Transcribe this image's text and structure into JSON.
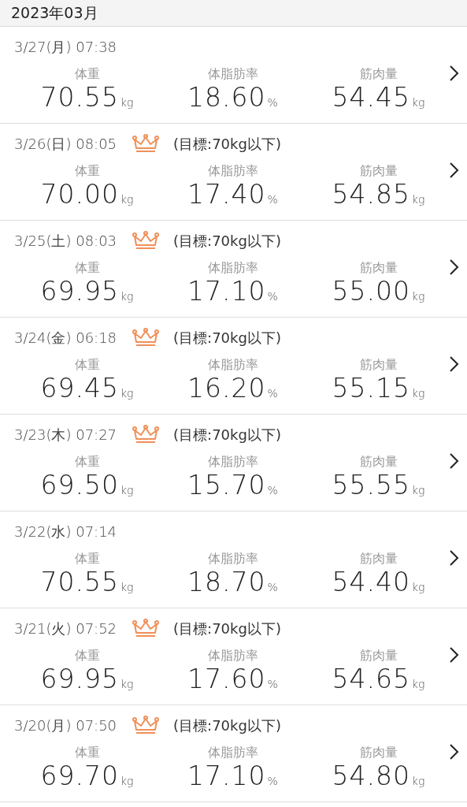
{
  "header": {
    "title": "2023年03月"
  },
  "entries": [
    {
      "date": "3/27(月)",
      "time": "07:38",
      "achieved": false,
      "metrics": [
        {
          "label": "体重",
          "value": "70.55",
          "unit": "kg"
        },
        {
          "label": "体脂肪率",
          "value": "18.60",
          "unit": "%"
        },
        {
          "label": "筋肉量",
          "value": "54.45",
          "unit": "kg"
        }
      ]
    },
    {
      "date": "3/26(日)",
      "time": "08:05",
      "achieved": true,
      "goal": "(目標:70kg以下)",
      "metrics": [
        {
          "label": "体重",
          "value": "70.00",
          "unit": "kg"
        },
        {
          "label": "体脂肪率",
          "value": "17.40",
          "unit": "%"
        },
        {
          "label": "筋肉量",
          "value": "54.85",
          "unit": "kg"
        }
      ]
    },
    {
      "date": "3/25(土)",
      "time": "08:03",
      "achieved": true,
      "goal": "(目標:70kg以下)",
      "metrics": [
        {
          "label": "体重",
          "value": "69.95",
          "unit": "kg"
        },
        {
          "label": "体脂肪率",
          "value": "17.10",
          "unit": "%"
        },
        {
          "label": "筋肉量",
          "value": "55.00",
          "unit": "kg"
        }
      ]
    },
    {
      "date": "3/24(金)",
      "time": "06:18",
      "achieved": true,
      "goal": "(目標:70kg以下)",
      "metrics": [
        {
          "label": "体重",
          "value": "69.45",
          "unit": "kg"
        },
        {
          "label": "体脂肪率",
          "value": "16.20",
          "unit": "%"
        },
        {
          "label": "筋肉量",
          "value": "55.15",
          "unit": "kg"
        }
      ]
    },
    {
      "date": "3/23(木)",
      "time": "07:27",
      "achieved": true,
      "goal": "(目標:70kg以下)",
      "metrics": [
        {
          "label": "体重",
          "value": "69.50",
          "unit": "kg"
        },
        {
          "label": "体脂肪率",
          "value": "15.70",
          "unit": "%"
        },
        {
          "label": "筋肉量",
          "value": "55.55",
          "unit": "kg"
        }
      ]
    },
    {
      "date": "3/22(水)",
      "time": "07:14",
      "achieved": false,
      "metrics": [
        {
          "label": "体重",
          "value": "70.55",
          "unit": "kg"
        },
        {
          "label": "体脂肪率",
          "value": "18.70",
          "unit": "%"
        },
        {
          "label": "筋肉量",
          "value": "54.40",
          "unit": "kg"
        }
      ]
    },
    {
      "date": "3/21(火)",
      "time": "07:52",
      "achieved": true,
      "goal": "(目標:70kg以下)",
      "metrics": [
        {
          "label": "体重",
          "value": "69.95",
          "unit": "kg"
        },
        {
          "label": "体脂肪率",
          "value": "17.60",
          "unit": "%"
        },
        {
          "label": "筋肉量",
          "value": "54.65",
          "unit": "kg"
        }
      ]
    },
    {
      "date": "3/20(月)",
      "time": "07:50",
      "achieved": true,
      "goal": "(目標:70kg以下)",
      "metrics": [
        {
          "label": "体重",
          "value": "69.70",
          "unit": "kg"
        },
        {
          "label": "体脂肪率",
          "value": "17.10",
          "unit": "%"
        },
        {
          "label": "筋肉量",
          "value": "54.80",
          "unit": "kg"
        }
      ]
    }
  ]
}
